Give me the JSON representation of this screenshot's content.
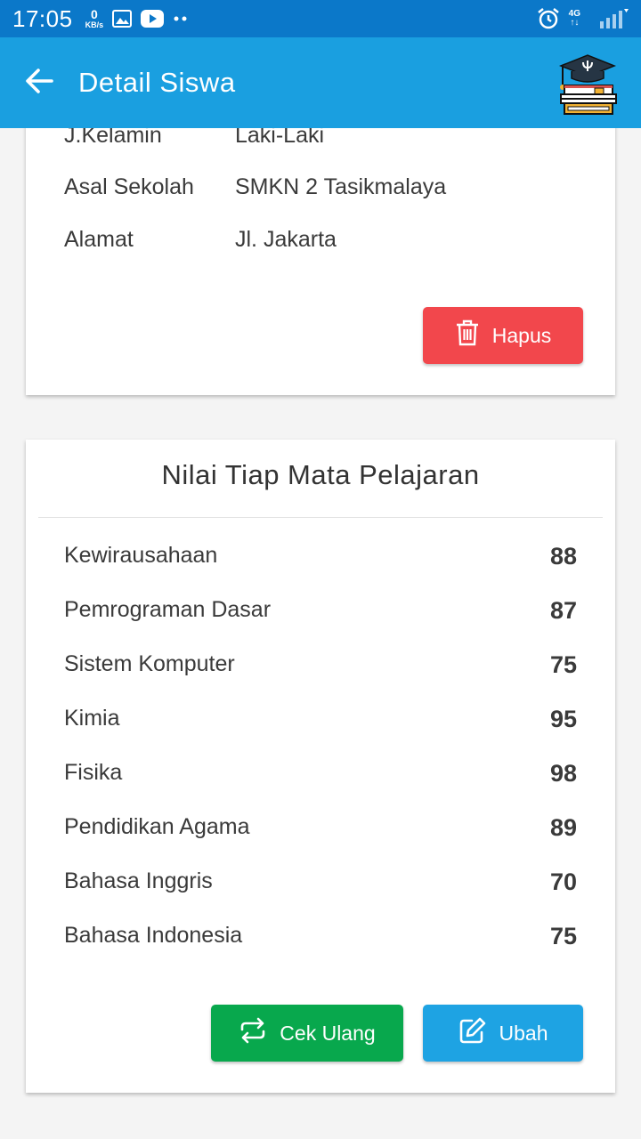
{
  "status_bar": {
    "time": "17:05",
    "speed_value": "0",
    "speed_unit": "KB/s",
    "network": "4G",
    "icons": [
      "image-icon",
      "youtube-icon",
      "dots-icon",
      "alarm-icon",
      "signal-icon"
    ]
  },
  "app_bar": {
    "title": "Detail Siswa",
    "back_icon": "arrow-left-icon",
    "logo_icon": "graduation-cap-books-icon"
  },
  "student_info": {
    "rows": [
      {
        "label": "J.Kelamin",
        "value": "Laki-Laki"
      },
      {
        "label": "Asal Sekolah",
        "value": "SMKN 2 Tasikmalaya"
      },
      {
        "label": "Alamat",
        "value": "Jl. Jakarta"
      }
    ],
    "delete_label": "Hapus"
  },
  "grades": {
    "title": "Nilai Tiap Mata Pelajaran",
    "items": [
      {
        "subject": "Kewirausahaan",
        "score": "88"
      },
      {
        "subject": "Pemrograman Dasar",
        "score": "87"
      },
      {
        "subject": "Sistem Komputer",
        "score": "75"
      },
      {
        "subject": "Kimia",
        "score": "95"
      },
      {
        "subject": "Fisika",
        "score": "98"
      },
      {
        "subject": "Pendidikan Agama",
        "score": "89"
      },
      {
        "subject": "Bahasa Inggris",
        "score": "70"
      },
      {
        "subject": "Bahasa Indonesia",
        "score": "75"
      }
    ],
    "recheck_label": "Cek Ulang",
    "edit_label": "Ubah"
  },
  "colors": {
    "status_bar": "#0b78c9",
    "app_bar": "#1a9fe0",
    "delete_button": "#f2474c",
    "recheck_button": "#08a84d",
    "edit_button": "#1ea3e3"
  }
}
